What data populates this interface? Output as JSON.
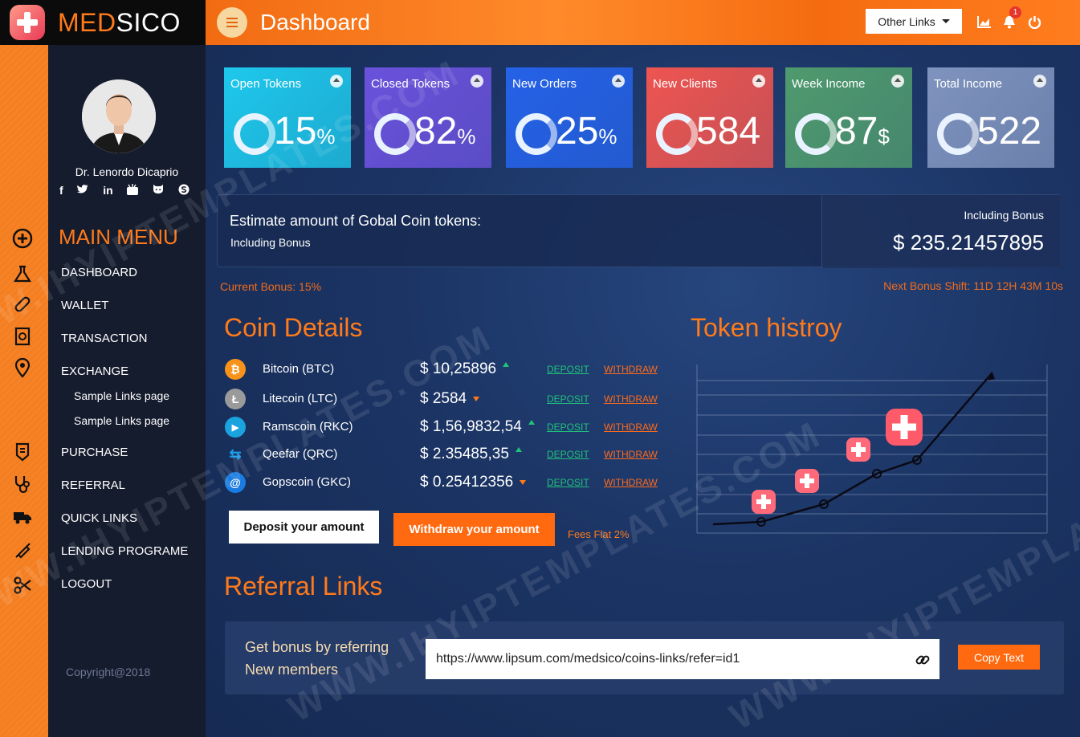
{
  "brand": {
    "name_part1": "MED",
    "name_part2": "SICO"
  },
  "header": {
    "title": "Dashboard",
    "other_links": "Other Links",
    "notification_count": "1"
  },
  "profile": {
    "name": "Dr. Lenordo Dicaprio"
  },
  "sidebar": {
    "menu_title": "MAIN MENU",
    "items": [
      {
        "label": "DASHBOARD"
      },
      {
        "label": "WALLET"
      },
      {
        "label": "TRANSACTION"
      },
      {
        "label": "EXCHANGE"
      },
      {
        "label": "Sample Links page"
      },
      {
        "label": "Sample Links page"
      },
      {
        "label": "PURCHASE"
      },
      {
        "label": "REFERRAL"
      },
      {
        "label": "QUICK LINKS"
      },
      {
        "label": "LENDING PROGRAME"
      },
      {
        "label": "LOGOUT"
      }
    ],
    "copyright": "Copyright@2018"
  },
  "stats": [
    {
      "label": "Open Tokens",
      "value": "15",
      "unit": "%",
      "color": "#1ec8ec"
    },
    {
      "label": "Closed Tokens",
      "value": "82",
      "unit": "%",
      "color": "#6a52dc"
    },
    {
      "label": "New Orders",
      "value": "25",
      "unit": "%",
      "color": "#2562e8"
    },
    {
      "label": "New Clients",
      "value": "584",
      "unit": "",
      "color": "#ee5550"
    },
    {
      "label": "Week Income",
      "value": "87",
      "unit": "$",
      "color": "#4f9a6e"
    },
    {
      "label": "Total Income",
      "value": "522",
      "unit": "",
      "color": "#7f93be"
    }
  ],
  "estimate": {
    "title": "Estimate amount of Gobal Coin tokens:",
    "subtitle": "Including Bonus",
    "bonus_label": "Including Bonus",
    "amount": "$ 235.21457895",
    "current_bonus": "Current Bonus:  15%",
    "next_bonus": "Next Bonus Shift: 11D 12H 43M 10s"
  },
  "coins": {
    "title": "Coin Details",
    "rows": [
      {
        "name": "Bitcoin (BTC)",
        "price": "$ 10,25896",
        "trend": "up",
        "deposit": "DEPOSIT",
        "withdraw": "WITHDRAW",
        "icon": "bitcoin-icon",
        "color": "#f7931a"
      },
      {
        "name": "Litecoin (LTC)",
        "price": "$ 2584",
        "trend": "down",
        "deposit": "DEPOSIT",
        "withdraw": "WITHDRAW",
        "icon": "litecoin-icon",
        "color": "#9a9a9a"
      },
      {
        "name": "Ramscoin (RKC)",
        "price": "$ 1,56,9832,54",
        "trend": "up",
        "deposit": "DEPOSIT",
        "withdraw": "WITHDRAW",
        "icon": "ramscoin-icon",
        "color": "#1ba3e0"
      },
      {
        "name": "Qeefar (QRC)",
        "price": "$ 2.35485,35",
        "trend": "up",
        "deposit": "DEPOSIT",
        "withdraw": "WITHDRAW",
        "icon": "qeefar-icon",
        "color": "#1a9be8"
      },
      {
        "name": "Gopscoin (GKC)",
        "price": "$ 0.25412356",
        "trend": "down",
        "deposit": "DEPOSIT",
        "withdraw": "WITHDRAW",
        "icon": "gopscoin-icon",
        "color": "#1a7be0"
      }
    ],
    "deposit_button": "Deposit your amount",
    "withdraw_button": "Withdraw your amount",
    "fees": "Fees Flat 2%"
  },
  "token_history": {
    "title": "Token histroy"
  },
  "referral": {
    "title": "Referral Links",
    "text_line1": "Get bonus by referring",
    "text_line2": "New members",
    "link_value": "https://www.lipsum.com/medsico/coins-links/refer=id1",
    "copy_button": "Copy Text"
  },
  "watermark": "WWW.IHYIPTEMPLATES.COM"
}
